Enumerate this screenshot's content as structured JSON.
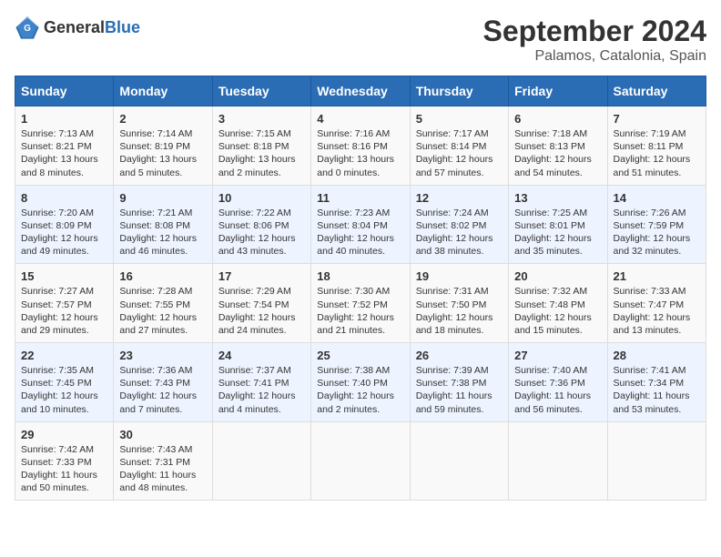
{
  "header": {
    "logo_general": "General",
    "logo_blue": "Blue",
    "month_year": "September 2024",
    "location": "Palamos, Catalonia, Spain"
  },
  "days_of_week": [
    "Sunday",
    "Monday",
    "Tuesday",
    "Wednesday",
    "Thursday",
    "Friday",
    "Saturday"
  ],
  "weeks": [
    [
      {
        "day": "1",
        "lines": [
          "Sunrise: 7:13 AM",
          "Sunset: 8:21 PM",
          "Daylight: 13 hours",
          "and 8 minutes."
        ]
      },
      {
        "day": "2",
        "lines": [
          "Sunrise: 7:14 AM",
          "Sunset: 8:19 PM",
          "Daylight: 13 hours",
          "and 5 minutes."
        ]
      },
      {
        "day": "3",
        "lines": [
          "Sunrise: 7:15 AM",
          "Sunset: 8:18 PM",
          "Daylight: 13 hours",
          "and 2 minutes."
        ]
      },
      {
        "day": "4",
        "lines": [
          "Sunrise: 7:16 AM",
          "Sunset: 8:16 PM",
          "Daylight: 13 hours",
          "and 0 minutes."
        ]
      },
      {
        "day": "5",
        "lines": [
          "Sunrise: 7:17 AM",
          "Sunset: 8:14 PM",
          "Daylight: 12 hours",
          "and 57 minutes."
        ]
      },
      {
        "day": "6",
        "lines": [
          "Sunrise: 7:18 AM",
          "Sunset: 8:13 PM",
          "Daylight: 12 hours",
          "and 54 minutes."
        ]
      },
      {
        "day": "7",
        "lines": [
          "Sunrise: 7:19 AM",
          "Sunset: 8:11 PM",
          "Daylight: 12 hours",
          "and 51 minutes."
        ]
      }
    ],
    [
      {
        "day": "8",
        "lines": [
          "Sunrise: 7:20 AM",
          "Sunset: 8:09 PM",
          "Daylight: 12 hours",
          "and 49 minutes."
        ]
      },
      {
        "day": "9",
        "lines": [
          "Sunrise: 7:21 AM",
          "Sunset: 8:08 PM",
          "Daylight: 12 hours",
          "and 46 minutes."
        ]
      },
      {
        "day": "10",
        "lines": [
          "Sunrise: 7:22 AM",
          "Sunset: 8:06 PM",
          "Daylight: 12 hours",
          "and 43 minutes."
        ]
      },
      {
        "day": "11",
        "lines": [
          "Sunrise: 7:23 AM",
          "Sunset: 8:04 PM",
          "Daylight: 12 hours",
          "and 40 minutes."
        ]
      },
      {
        "day": "12",
        "lines": [
          "Sunrise: 7:24 AM",
          "Sunset: 8:02 PM",
          "Daylight: 12 hours",
          "and 38 minutes."
        ]
      },
      {
        "day": "13",
        "lines": [
          "Sunrise: 7:25 AM",
          "Sunset: 8:01 PM",
          "Daylight: 12 hours",
          "and 35 minutes."
        ]
      },
      {
        "day": "14",
        "lines": [
          "Sunrise: 7:26 AM",
          "Sunset: 7:59 PM",
          "Daylight: 12 hours",
          "and 32 minutes."
        ]
      }
    ],
    [
      {
        "day": "15",
        "lines": [
          "Sunrise: 7:27 AM",
          "Sunset: 7:57 PM",
          "Daylight: 12 hours",
          "and 29 minutes."
        ]
      },
      {
        "day": "16",
        "lines": [
          "Sunrise: 7:28 AM",
          "Sunset: 7:55 PM",
          "Daylight: 12 hours",
          "and 27 minutes."
        ]
      },
      {
        "day": "17",
        "lines": [
          "Sunrise: 7:29 AM",
          "Sunset: 7:54 PM",
          "Daylight: 12 hours",
          "and 24 minutes."
        ]
      },
      {
        "day": "18",
        "lines": [
          "Sunrise: 7:30 AM",
          "Sunset: 7:52 PM",
          "Daylight: 12 hours",
          "and 21 minutes."
        ]
      },
      {
        "day": "19",
        "lines": [
          "Sunrise: 7:31 AM",
          "Sunset: 7:50 PM",
          "Daylight: 12 hours",
          "and 18 minutes."
        ]
      },
      {
        "day": "20",
        "lines": [
          "Sunrise: 7:32 AM",
          "Sunset: 7:48 PM",
          "Daylight: 12 hours",
          "and 15 minutes."
        ]
      },
      {
        "day": "21",
        "lines": [
          "Sunrise: 7:33 AM",
          "Sunset: 7:47 PM",
          "Daylight: 12 hours",
          "and 13 minutes."
        ]
      }
    ],
    [
      {
        "day": "22",
        "lines": [
          "Sunrise: 7:35 AM",
          "Sunset: 7:45 PM",
          "Daylight: 12 hours",
          "and 10 minutes."
        ]
      },
      {
        "day": "23",
        "lines": [
          "Sunrise: 7:36 AM",
          "Sunset: 7:43 PM",
          "Daylight: 12 hours",
          "and 7 minutes."
        ]
      },
      {
        "day": "24",
        "lines": [
          "Sunrise: 7:37 AM",
          "Sunset: 7:41 PM",
          "Daylight: 12 hours",
          "and 4 minutes."
        ]
      },
      {
        "day": "25",
        "lines": [
          "Sunrise: 7:38 AM",
          "Sunset: 7:40 PM",
          "Daylight: 12 hours",
          "and 2 minutes."
        ]
      },
      {
        "day": "26",
        "lines": [
          "Sunrise: 7:39 AM",
          "Sunset: 7:38 PM",
          "Daylight: 11 hours",
          "and 59 minutes."
        ]
      },
      {
        "day": "27",
        "lines": [
          "Sunrise: 7:40 AM",
          "Sunset: 7:36 PM",
          "Daylight: 11 hours",
          "and 56 minutes."
        ]
      },
      {
        "day": "28",
        "lines": [
          "Sunrise: 7:41 AM",
          "Sunset: 7:34 PM",
          "Daylight: 11 hours",
          "and 53 minutes."
        ]
      }
    ],
    [
      {
        "day": "29",
        "lines": [
          "Sunrise: 7:42 AM",
          "Sunset: 7:33 PM",
          "Daylight: 11 hours",
          "and 50 minutes."
        ]
      },
      {
        "day": "30",
        "lines": [
          "Sunrise: 7:43 AM",
          "Sunset: 7:31 PM",
          "Daylight: 11 hours",
          "and 48 minutes."
        ]
      },
      {
        "day": "",
        "lines": []
      },
      {
        "day": "",
        "lines": []
      },
      {
        "day": "",
        "lines": []
      },
      {
        "day": "",
        "lines": []
      },
      {
        "day": "",
        "lines": []
      }
    ]
  ]
}
